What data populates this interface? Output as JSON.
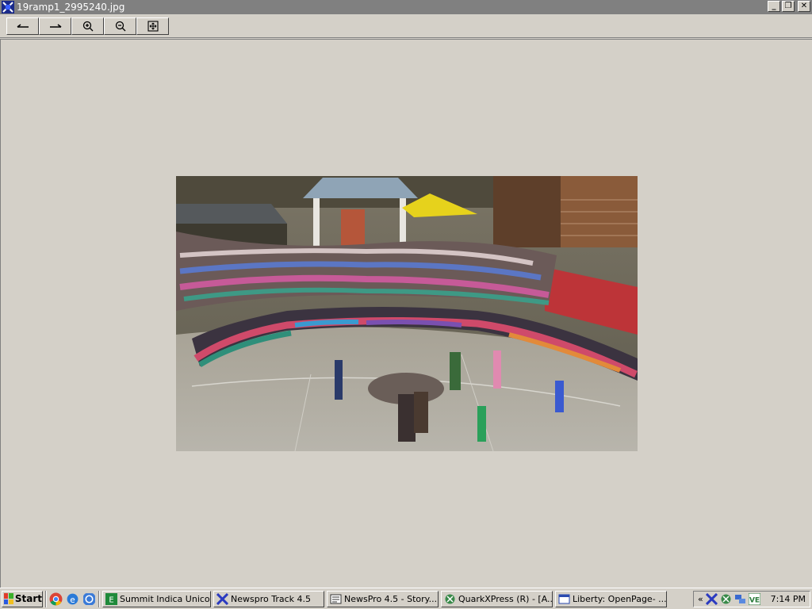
{
  "window": {
    "title": "19ramp1_2995240.jpg",
    "minimize": "_",
    "restore": "❐",
    "close": "✕"
  },
  "toolbar": {
    "buttons": [
      {
        "name": "previous",
        "icon": "arrow-left-icon"
      },
      {
        "name": "next",
        "icon": "arrow-right-icon"
      },
      {
        "name": "zoom-in",
        "icon": "zoom-in-icon"
      },
      {
        "name": "zoom-out",
        "icon": "zoom-out-icon"
      },
      {
        "name": "fit",
        "icon": "fit-window-icon"
      }
    ]
  },
  "taskbar": {
    "start_label": "Start",
    "tasks": [
      {
        "label": "Summit Indica Unicode",
        "icon": "summit-icon"
      },
      {
        "label": "Newspro Track 4.5",
        "icon": "newspro-icon"
      },
      {
        "label": "NewsPro 4.5 - Story...",
        "icon": "story-icon"
      },
      {
        "label": "QuarkXPress (R) - [A...",
        "icon": "quark-icon"
      },
      {
        "label": "Liberty: OpenPage- ...",
        "icon": "window-icon"
      }
    ],
    "tray_chevron": "«",
    "clock": "7:14 PM"
  },
  "colors": {
    "titlebar": "#808080",
    "chrome": "#d4d0c8"
  }
}
